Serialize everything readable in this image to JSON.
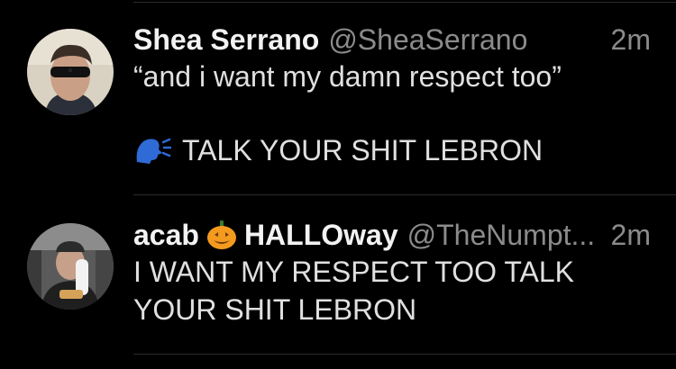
{
  "timeline": {
    "tweets": [
      {
        "name": "Shea Serrano",
        "handle": "@SheaSerrano",
        "time": "2m",
        "line1": "“and i want my damn respect too”",
        "line2": "TALK YOUR SHIT LEBRON",
        "speaking_emoji": "speaking-head-icon"
      },
      {
        "name_part1": "acab",
        "name_emoji": "jack-o-lantern-icon",
        "name_part2": "HALLOway",
        "handle": "@TheNumpt...",
        "time": "2m",
        "line1": "I WANT MY RESPECT TOO TALK",
        "line2": "YOUR SHIT LEBRON"
      }
    ]
  },
  "colors": {
    "background": "#000000",
    "name": "#f2f2f2",
    "meta": "#8b8b8b",
    "pumpkin": "#f39a1f"
  }
}
